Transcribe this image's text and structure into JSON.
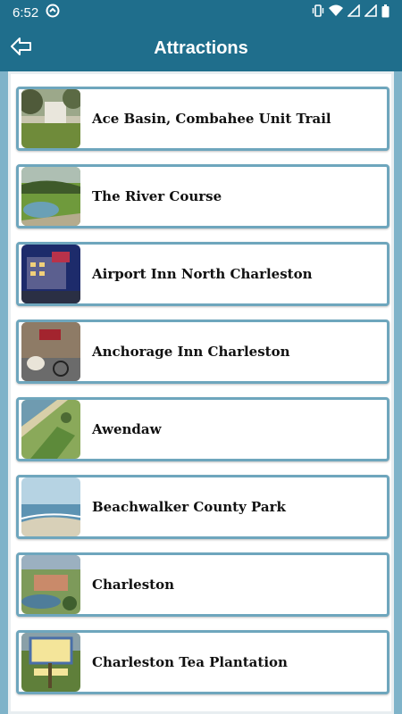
{
  "status_bar": {
    "time": "6:52"
  },
  "header": {
    "title": "Attractions"
  },
  "attractions": [
    {
      "label": "Ace Basin, Combahee Unit Trail"
    },
    {
      "label": "The River Course"
    },
    {
      "label": "Airport Inn North Charleston"
    },
    {
      "label": "Anchorage Inn Charleston"
    },
    {
      "label": "Awendaw"
    },
    {
      "label": "Beachwalker County Park"
    },
    {
      "label": "Charleston"
    },
    {
      "label": "Charleston Tea Plantation"
    }
  ],
  "colors": {
    "primary": "#1f6e8c",
    "frame": "#7fb3c9",
    "item_border": "#6ea6bd"
  }
}
